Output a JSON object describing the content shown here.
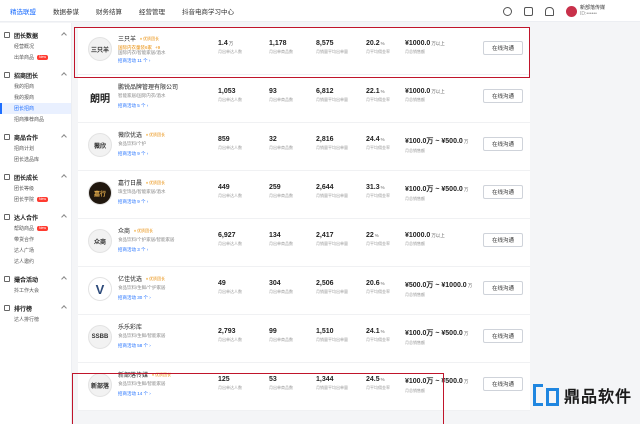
{
  "topnav": [
    {
      "label": "精选联盟",
      "active": true
    },
    {
      "label": "数据参谋",
      "active": false
    },
    {
      "label": "财务结算",
      "active": false
    },
    {
      "label": "经营管理",
      "active": false
    },
    {
      "label": "抖音电商学习中心",
      "active": false
    }
  ],
  "user": {
    "name": "新部落传媒",
    "sub": "ID:••••••"
  },
  "sidebar": [
    {
      "head": "团长数据",
      "items": [
        {
          "label": "经营概况",
          "badge": "",
          "active": false
        },
        {
          "label": "出单商品",
          "badge": "New",
          "active": false
        }
      ]
    },
    {
      "head": "招商团长",
      "items": [
        {
          "label": "我的招商",
          "badge": "",
          "active": false
        },
        {
          "label": "我的报商",
          "badge": "",
          "active": false
        },
        {
          "label": "团长招商",
          "badge": "",
          "active": true
        },
        {
          "label": "招商推荐商品",
          "badge": "",
          "active": false
        }
      ]
    },
    {
      "head": "商品合作",
      "items": [
        {
          "label": "招商计划",
          "badge": "",
          "active": false
        },
        {
          "label": "团长选品库",
          "badge": "",
          "active": false
        }
      ]
    },
    {
      "head": "团长成长",
      "items": [
        {
          "label": "团长等级",
          "badge": "",
          "active": false
        },
        {
          "label": "团长学院",
          "badge": "New",
          "active": false
        }
      ]
    },
    {
      "head": "达人合作",
      "items": [
        {
          "label": "帮助商品",
          "badge": "New",
          "active": false
        },
        {
          "label": "带货合作",
          "badge": "",
          "active": false
        },
        {
          "label": "达人广场",
          "badge": "",
          "active": false
        },
        {
          "label": "达人邀约",
          "badge": "",
          "active": false
        }
      ]
    },
    {
      "head": "撮合活动",
      "items": [
        {
          "label": "抖工作大会",
          "badge": "",
          "active": false
        }
      ]
    },
    {
      "head": "排行榜",
      "items": [
        {
          "label": "达人排行榜",
          "badge": "",
          "active": false
        }
      ]
    }
  ],
  "stat_labels": [
    "月出单达人数",
    "月出单商品数",
    "月销量平均出单量",
    "月平均佣金率",
    "月总销售额"
  ],
  "action_label": "在线沟通",
  "rows": [
    {
      "name": "三只羊",
      "tag": "优质团长",
      "logo": "三只羊",
      "logo_style": "normal",
      "sub_type": "mpp",
      "mpp_text": "国际内衣童装6家",
      "mpp_plus": "+9",
      "category": "国际内衣/智能家居/酒水",
      "link": "招商活动 11 个 ›",
      "stats": [
        "1.4",
        "1,178",
        "8,575",
        "20.2",
        "¥1000.0"
      ],
      "units": [
        "万",
        "",
        "",
        "%",
        "万以上"
      ]
    },
    {
      "name": "鹏锐品牌管理有限公司",
      "tag": "",
      "logo": "朗明",
      "logo_style": "text",
      "sub_type": "cat",
      "category": "智能家居/国际内衣/酒水",
      "link": "招商活动 5 个 ›",
      "stats": [
        "1,053",
        "93",
        "6,812",
        "22.1",
        "¥1000.0"
      ],
      "units": [
        "",
        "",
        "",
        "%",
        "万以上"
      ]
    },
    {
      "name": "薇欣优选",
      "tag": "优质团长",
      "logo": "薇欣",
      "logo_style": "normal",
      "sub_type": "cat",
      "category": "食品饮料/个护",
      "link": "招商活动 9 个 ›",
      "stats": [
        "859",
        "32",
        "2,816",
        "24.4",
        "¥100.0万 ~ ¥500.0"
      ],
      "units": [
        "",
        "",
        "",
        "%",
        "万"
      ]
    },
    {
      "name": "嘉行日晨",
      "tag": "优质团长",
      "logo": "嘉行",
      "logo_style": "dark",
      "sub_type": "cat",
      "category": "珠宝饰品/智能家居/酒水",
      "link": "招商活动 9 个 ›",
      "stats": [
        "449",
        "259",
        "2,644",
        "31.3",
        "¥100.0万 ~ ¥500.0"
      ],
      "units": [
        "",
        "",
        "",
        "%",
        "万"
      ]
    },
    {
      "name": "众商",
      "tag": "优质团长",
      "logo": "众商",
      "logo_style": "normal",
      "sub_type": "cat",
      "category": "食品饮料/个护家居/智能家居",
      "link": "招商活动 3 个 ›",
      "stats": [
        "6,927",
        "134",
        "2,417",
        "22",
        "¥1000.0"
      ],
      "units": [
        "",
        "",
        "",
        "%",
        "万以上"
      ]
    },
    {
      "name": "亿佳优选",
      "tag": "优质团长",
      "logo": "V",
      "logo_style": "v",
      "sub_type": "cat",
      "category": "食品饮料/生鲜/个护家居",
      "link": "招商活动 30 个 ›",
      "stats": [
        "49",
        "304",
        "2,506",
        "20.6",
        "¥500.0万 ~ ¥1000.0"
      ],
      "units": [
        "",
        "",
        "",
        "%",
        "万"
      ]
    },
    {
      "name": "乐乐彩库",
      "tag": "",
      "logo": "SSBB",
      "logo_style": "normal",
      "sub_type": "cat",
      "category": "食品饮料/生鲜/智能家居",
      "link": "招商活动 58 个 ›",
      "stats": [
        "2,793",
        "99",
        "1,510",
        "24.1",
        "¥100.0万 ~ ¥500.0"
      ],
      "units": [
        "",
        "",
        "",
        "%",
        "万"
      ]
    },
    {
      "name": "新部落传媒",
      "tag": "优质团长",
      "logo": "新部落",
      "logo_style": "normal",
      "sub_type": "cat",
      "category": "食品饮料/生鲜/智能家居",
      "link": "招商活动 14 个 ›",
      "stats": [
        "125",
        "53",
        "1,344",
        "24.5",
        "¥100.0万 ~ ¥500.0"
      ],
      "units": [
        "",
        "",
        "",
        "%",
        "万"
      ]
    }
  ],
  "watermark": {
    "text": "鼎品软件"
  },
  "colors": {
    "accent": "#1e6fff",
    "highlight": "#c0152b",
    "tag": "#e88a00"
  }
}
